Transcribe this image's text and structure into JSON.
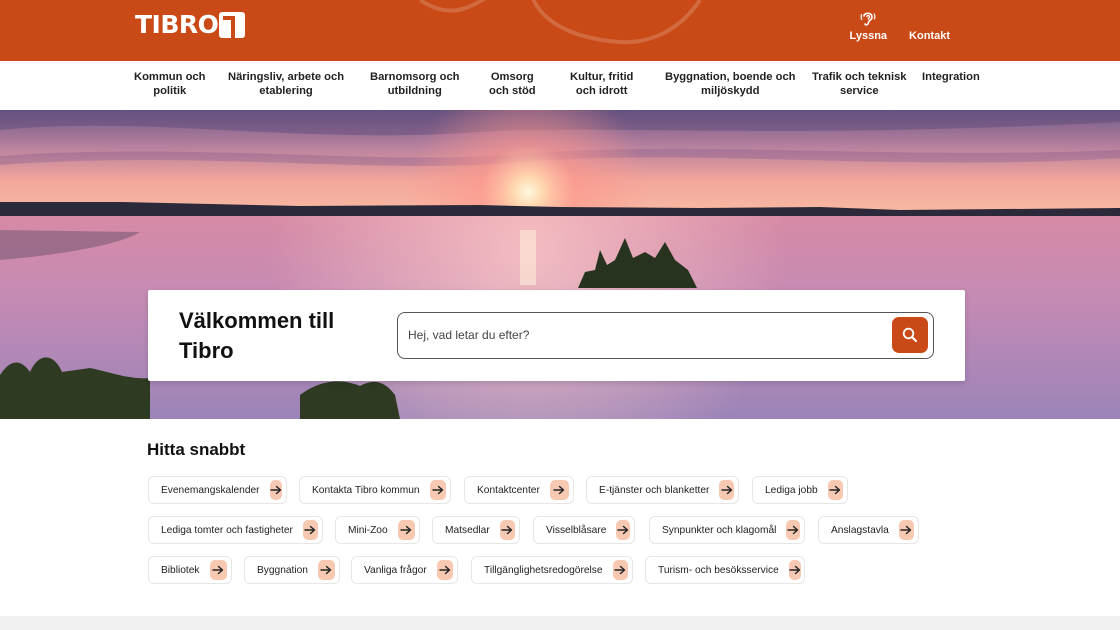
{
  "brand": {
    "logo_text": "TIBRO",
    "primary_color": "#c94a16",
    "chip_arrow_bg": "#f7c9b3"
  },
  "header": {
    "actions": [
      {
        "label": "Lyssna",
        "icon": "ear-icon"
      },
      {
        "label": "Kontakt",
        "icon": ""
      }
    ]
  },
  "nav": {
    "items": [
      {
        "label": "Kommun och\npolitik"
      },
      {
        "label": "Näringsliv, arbete och\netablering"
      },
      {
        "label": "Barnomsorg och\nutbildning"
      },
      {
        "label": "Omsorg\noch stöd"
      },
      {
        "label": "Kultur, fritid\noch idrott"
      },
      {
        "label": "Byggnation, boende och\nmiljöskydd"
      },
      {
        "label": "Trafik och teknisk\nservice"
      },
      {
        "label": "Integration"
      }
    ]
  },
  "hero": {
    "title": "Välkommen till Tibro",
    "search": {
      "placeholder": "Hej, vad letar du efter?",
      "value": "",
      "button_icon": "search-icon"
    }
  },
  "quick_links": {
    "title": "Hitta snabbt",
    "items": [
      "Evenemangskalender",
      "Kontakta Tibro kommun",
      "Kontaktcenter",
      "E-tjänster och blanketter",
      "Lediga jobb",
      "Lediga tomter och fastigheter",
      "Mini-Zoo",
      "Matsedlar",
      "Visselblåsare",
      "Synpunkter och klagomål",
      "Anslagstavla",
      "Bibliotek",
      "Byggnation",
      "Vanliga frågor",
      "Tillgänglighetsredogörelse",
      "Turism- och besöksservice"
    ]
  }
}
